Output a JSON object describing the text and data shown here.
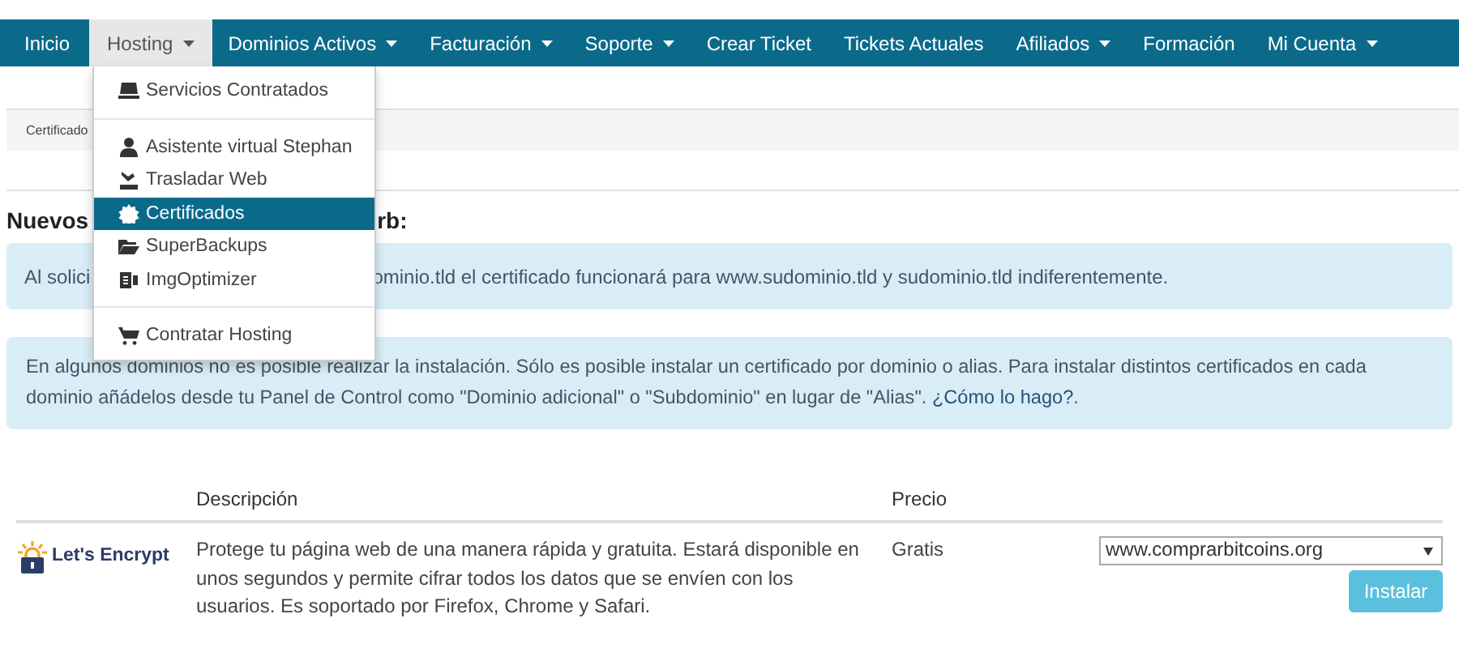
{
  "nav": [
    {
      "label": "Inicio",
      "caret": false,
      "selected": false
    },
    {
      "label": "Hosting",
      "caret": true,
      "selected": true
    },
    {
      "label": "Dominios Activos",
      "caret": true,
      "selected": false
    },
    {
      "label": "Facturación",
      "caret": true,
      "selected": false
    },
    {
      "label": "Soporte",
      "caret": true,
      "selected": false
    },
    {
      "label": "Crear Ticket",
      "caret": false,
      "selected": false
    },
    {
      "label": "Tickets Actuales",
      "caret": false,
      "selected": false
    },
    {
      "label": "Afiliados",
      "caret": true,
      "selected": false
    },
    {
      "label": "Formación",
      "caret": false,
      "selected": false
    },
    {
      "label": "Mi Cuenta",
      "caret": true,
      "selected": false
    }
  ],
  "dropdown": [
    {
      "kind": "item",
      "label": "Servicios Contratados",
      "selected": false
    },
    {
      "kind": "divider"
    },
    {
      "kind": "item",
      "label": "Asistente virtual Stephan",
      "selected": false
    },
    {
      "kind": "item",
      "label": "Trasladar Web",
      "selected": false
    },
    {
      "kind": "item",
      "label": "Certificados",
      "selected": true
    },
    {
      "kind": "item",
      "label": "SuperBackups",
      "selected": false
    },
    {
      "kind": "item",
      "label": "ImgOptimizer",
      "selected": false
    },
    {
      "kind": "divider"
    },
    {
      "kind": "item",
      "label": "Contratar Hosting",
      "selected": false
    }
  ],
  "breadcrumb": "Certificado",
  "heading": {
    "left": "Nuevos",
    "right": "rb:"
  },
  "alert_1": {
    "left": "Al solici",
    "right": "ominio.tld el certificado funcionará para www.sudominio.tld y sudominio.tld indiferentemente."
  },
  "alert_2": {
    "text": "En algunos dominios no es posible realizar la instalación. Sólo es posible instalar un certificado por dominio o alias. Para instalar distintos certificados en cada dominio añádelos desde tu Panel de Control como \"Dominio adicional\" o \"Subdominio\" en lugar de \"Alias\".",
    "link": "¿Cómo lo hago?",
    "after": "."
  },
  "table": {
    "columns": [
      "Descripción",
      "Precio"
    ],
    "rows": [
      {
        "provider": "Let's Encrypt",
        "description": "Protege tu página web de una manera rápida y gratuita. Estará disponible en unos segundos y permite cifrar todos los datos que se envíen con los usuarios. Es soportado por Firefox, Chrome y Safari.",
        "price": "Gratis",
        "domain": "www.comprarbitcoins.org",
        "button": "Instalar"
      }
    ]
  }
}
